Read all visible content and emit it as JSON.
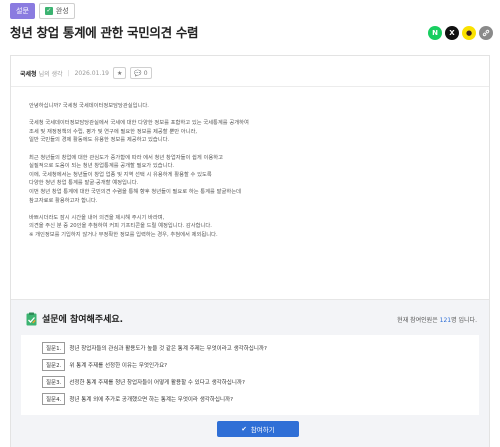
{
  "header": {
    "category_badge": "설문",
    "status_badge": "완성",
    "title": "청년 창업 통계에 관한 국민의견 수렴"
  },
  "share": [
    {
      "icon": "naver-icon",
      "label": "N"
    },
    {
      "icon": "x-icon",
      "label": "X"
    },
    {
      "icon": "kakao-icon",
      "label": "●"
    },
    {
      "icon": "link-icon",
      "label": "🔗"
    }
  ],
  "meta": {
    "author": "국세청",
    "author_suffix": "님의 생각",
    "date": "2026.01.19",
    "like_label": "★",
    "comment_label": "💬 0"
  },
  "body": [
    "안녕하십니까? 국세청 국세데이터정보담당관실입니다.",
    "",
    "국세청 국세데이터정보담당관실에서 국세에 대한 다양한 정보를 포함하고 있는 국세통계를 공개하여",
    "조세 및 재정정책의 수립, 평가 및 연구에 필요한 정보를 제공할 뿐만 아니라,",
    "일반 국민들의 경제 활동에도 유용한 정보를 제공하고 있습니다.",
    "",
    "최근 청년들의 창업에 대한 관심도가 증가함에 따라 에서 청년 창업자들이 쉽게 이용하고",
    "실질적으로 도움이 되는 청년 창업통계를 공개할 필요가 있습니다.",
    "이에, 국세청에서는 청년들이 창업 업종 및 지역 선택 시 유용하게 활용할 수 있도록",
    "다양한 청년 창업 통계를 발굴·공개할 예정입니다.",
    "이번 청년 창업 통계에 대한 국민의견 수렴을 통해 향후 청년들이 필요로 하는 통계를 발굴하는데",
    "참고자료로 활용하고자 합니다.",
    "",
    "바쁘시더라도 잠시 시간을 내어 의견을 제시해 주시기 바라며,",
    "의견을 주신 분 중 20인을 추첨하여 커피 기프티콘을 드릴 예정입니다. 감사합니다.",
    "※ 개인정보를 기입하지 않거나 부정확한 정보를 입력하는 경우, 추첨에서 제외됩니다."
  ],
  "survey": {
    "title": "설문에 참여해주세요.",
    "participants_prefix": "현재 참여인원은 ",
    "participants_count": "121",
    "participants_suffix": "명 입니다.",
    "questions": [
      {
        "tag": "질문1.",
        "text": "청년 창업자들의 관심과 활용도가 높을 것 같은 통계 주제는 무엇이라고 생각하십니까?"
      },
      {
        "tag": "질문2.",
        "text": "위 통계 주제를 선정한 이유는 무엇인가요?"
      },
      {
        "tag": "질문3.",
        "text": "선정한 통계 주제를 청년 창업자들이 어떻게 활용할 수 있다고 생각하십니까?"
      },
      {
        "tag": "질문4.",
        "text": "청년 통계 외에 추가로 공개했으면 하는 통계는 무엇이라 생각하십니까?"
      }
    ],
    "button_label": "참여하기"
  },
  "colors": {
    "accent": "#2f6fd6",
    "category_badge": "#8a7be0",
    "naver": "#19ce60",
    "kakao": "#fae100"
  }
}
